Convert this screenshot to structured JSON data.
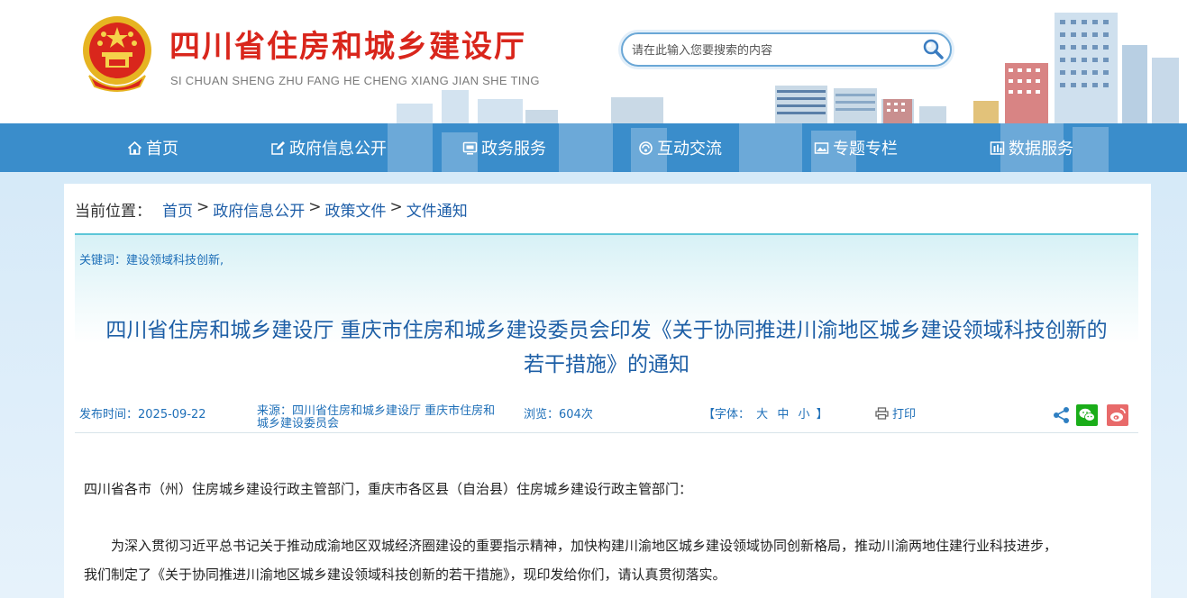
{
  "header": {
    "title": "四川省住房和城乡建设厅",
    "subtitle": "SI CHUAN SHENG ZHU FANG HE CHENG XIANG JIAN SHE TING",
    "search_placeholder": "请在此输入您要搜索的内容",
    "brand_color": "#d9261c"
  },
  "nav": {
    "items": [
      {
        "label": "首页",
        "icon": "home-icon"
      },
      {
        "label": "政府信息公开",
        "icon": "edit-icon"
      },
      {
        "label": "政务服务",
        "icon": "monitor-icon"
      },
      {
        "label": "互动交流",
        "icon": "interact-icon"
      },
      {
        "label": "专题专栏",
        "icon": "image-icon"
      },
      {
        "label": "数据服务",
        "icon": "data-icon"
      }
    ],
    "color": "#3a8dcb"
  },
  "breadcrumb": {
    "prefix": "当前位置：",
    "items": [
      "首页",
      "政府信息公开",
      "政策文件",
      "文件通知"
    ],
    "separator": ">"
  },
  "article": {
    "keywords": "关键词：建设领域科技创新,",
    "title_line1": "四川省住房和城乡建设厅 重庆市住房和城乡建设委员会印发《关于协同推进川渝地区城乡建设领域科技创新的",
    "title_line2": "若干措施》的通知",
    "publish_time": "发布时间：2025-09-22",
    "source_line1": "来源：四川省住房和城乡建设厅 重庆市住房和",
    "source_line2": "城乡建设委员会",
    "views": "浏览：604次",
    "font_label_open": "【字体：",
    "font_sizes": [
      "大",
      "中",
      "小"
    ],
    "font_label_close": "】",
    "print_label": "打印",
    "body": [
      "四川省各市（州）住房城乡建设行政主管部门，重庆市各区县（自治县）住房城乡建设行政主管部门：",
      "为深入贯彻习近平总书记关于推动成渝地区双城经济圈建设的重要指示精神，加快构建川渝地区城乡建设领域协同创新格局，推动川渝两地住建行业科技进步，",
      "我们制定了《关于协同推进川渝地区城乡建设领域科技创新的若干措施》，现印发给你们，请认真贯彻落实。"
    ]
  }
}
